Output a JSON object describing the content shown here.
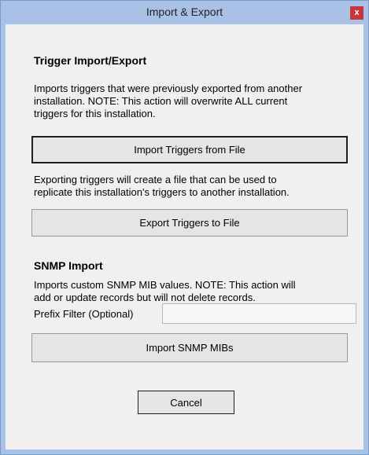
{
  "window": {
    "title": "Import & Export",
    "close_glyph": "x"
  },
  "trigger_section": {
    "heading": "Trigger Import/Export",
    "import_desc_lines": [
      "Imports triggers that were previously exported from another",
      "installation.  NOTE: This action will overwrite ALL current",
      "triggers for this installation."
    ],
    "import_button": "Import Triggers from File",
    "export_desc_lines": [
      "Exporting triggers will create a file that can be used to",
      "replicate this installation's triggers to another installation."
    ],
    "export_button": "Export Triggers to File"
  },
  "snmp_section": {
    "heading": "SNMP Import",
    "desc_lines": [
      "Imports custom SNMP MIB values.  NOTE: This action will",
      "add or update records but will not delete records."
    ],
    "prefix_label": "Prefix Filter (Optional)",
    "prefix_value": "",
    "import_button": "Import SNMP MIBs"
  },
  "footer": {
    "cancel_button": "Cancel"
  },
  "colors": {
    "frame": "#a9c1e6",
    "close_button": "#c7373a",
    "client_background": "#f0f0f0",
    "button_face": "#e5e5e5"
  }
}
